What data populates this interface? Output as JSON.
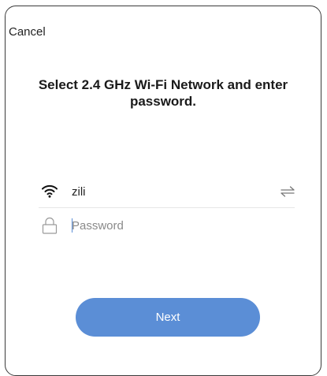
{
  "header": {
    "cancel_label": "Cancel"
  },
  "title": "Select 2.4 GHz Wi-Fi Network and enter password.",
  "network": {
    "ssid": "zili",
    "wifi_icon": "wifi-icon",
    "switch_icon": "swap-arrows-icon"
  },
  "password": {
    "value": "",
    "placeholder": "Password",
    "lock_icon": "lock-icon"
  },
  "actions": {
    "next_label": "Next"
  },
  "colors": {
    "accent": "#5b8ed6",
    "text": "#222222",
    "placeholder": "#8a8a8a",
    "divider": "#e6e6e6"
  }
}
